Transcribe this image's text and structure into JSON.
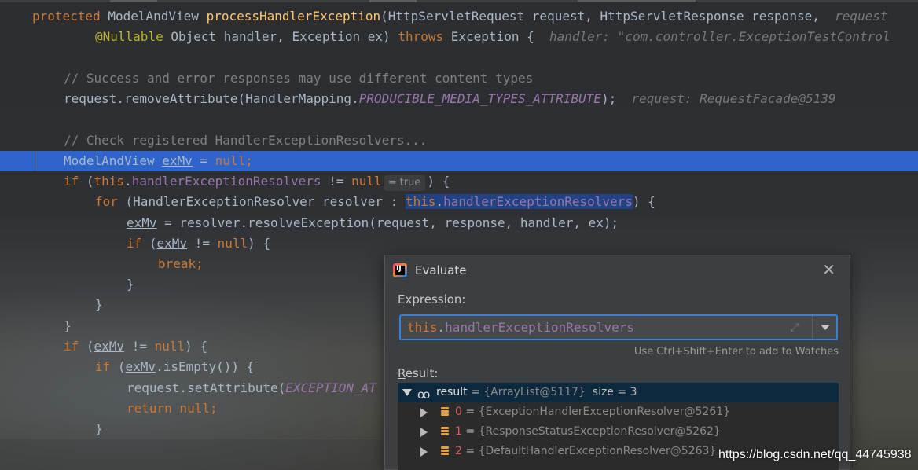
{
  "code": {
    "line1": {
      "kw_protected": "protected",
      "type_model": "ModelAndView",
      "method": "processHandlerException",
      "params": "(HttpServletRequest request, HttpServletResponse response, ",
      "hint_request": "request"
    },
    "line2": {
      "annotation": "@Nullable",
      "params": " Object handler, Exception ex) ",
      "kw_throws": "throws",
      "exc": " Exception {",
      "hint_handler": "handler: \"com.controller.ExceptionTestControl"
    },
    "line3_comment": "// Success and error responses may use different content types",
    "line4": {
      "call": "request.removeAttribute(HandlerMapping.",
      "const": "PRODUCIBLE_MEDIA_TYPES_ATTRIBUTE",
      "end": ");",
      "hint": "request: RequestFacade@5139"
    },
    "line5_comment": "// Check registered HandlerExceptionResolvers...",
    "line6": {
      "type": "ModelAndView ",
      "var": "exMv",
      "mid": " = ",
      "kw_null": "null",
      "end": ";"
    },
    "line7": {
      "kw_if": "if",
      "open": " (",
      "kw_this": "this",
      "dot": ".",
      "field": "handlerExceptionResolvers",
      "op": " != ",
      "kw_null": "null",
      "inlay": "= true",
      "end": ") {"
    },
    "line8": {
      "kw_for": "for",
      "decl": " (HandlerExceptionResolver resolver : ",
      "kw_this": "this",
      "dot": ".",
      "field": "handlerExceptionResolvers",
      "end": ") {"
    },
    "line9": {
      "var": "exMv",
      "rest": " = resolver.resolveException(request, response, handler, ex);"
    },
    "line10": {
      "kw_if": "if",
      "open": " (",
      "var": "exMv",
      "op": " != ",
      "kw_null": "null",
      "end": ") {"
    },
    "line11": {
      "kw_break": "break;"
    },
    "line12": "}",
    "line13": "}",
    "line14": "}",
    "line15": {
      "kw_if": "if",
      "open": " (",
      "var": "exMv",
      "op": " != ",
      "kw_null": "null",
      "end": ") {"
    },
    "line16": {
      "kw_if": "if",
      "open": " (",
      "var": "exMv",
      "end": ".isEmpty()) {"
    },
    "line17": {
      "call": "request.setAttribute(",
      "const": "EXCEPTION_AT"
    },
    "line18": {
      "kw_return": "return",
      "rest": " null;"
    },
    "line19": "}"
  },
  "dialog": {
    "title": "Evaluate",
    "close_glyph": "✕",
    "expression_label": "Expression:",
    "expression": {
      "kw_this": "this",
      "dot": ".",
      "field": "handlerExceptionResolvers"
    },
    "expand_glyph": "⤢",
    "watch_hint": "Use Ctrl+Shift+Enter to add to Watches",
    "result_label_first": "R",
    "result_label_rest": "esult:",
    "result": {
      "name": "result",
      "eq": " = ",
      "value": "{ArrayList@5117}",
      "size": "  size = 3",
      "items": [
        {
          "index": "0",
          "eq": " = ",
          "value": "{ExceptionHandlerExceptionResolver@5261}"
        },
        {
          "index": "1",
          "eq": " = ",
          "value": "{ResponseStatusExceptionResolver@5262}"
        },
        {
          "index": "2",
          "eq": " = ",
          "value": "{DefaultHandlerExceptionResolver@5263}"
        }
      ]
    }
  },
  "watermark": "https://blog.csdn.net/qq_44745938",
  "colors": {
    "execution_line": "#2f65ca",
    "keyword": "#cc7832",
    "method": "#ffc66d",
    "field": "#9876aa",
    "comment": "#808080",
    "annotation": "#bbb529",
    "focus_border": "#3d7fd6"
  },
  "icons": {
    "app": "intellij-logo-icon",
    "close": "close-icon",
    "expand": "expand-icon",
    "dropdown": "chevron-down-icon",
    "watch": "watch-glasses-icon",
    "field": "field-icon",
    "tree_expanded": "tree-expanded-icon",
    "tree_collapsed": "tree-collapsed-icon"
  }
}
